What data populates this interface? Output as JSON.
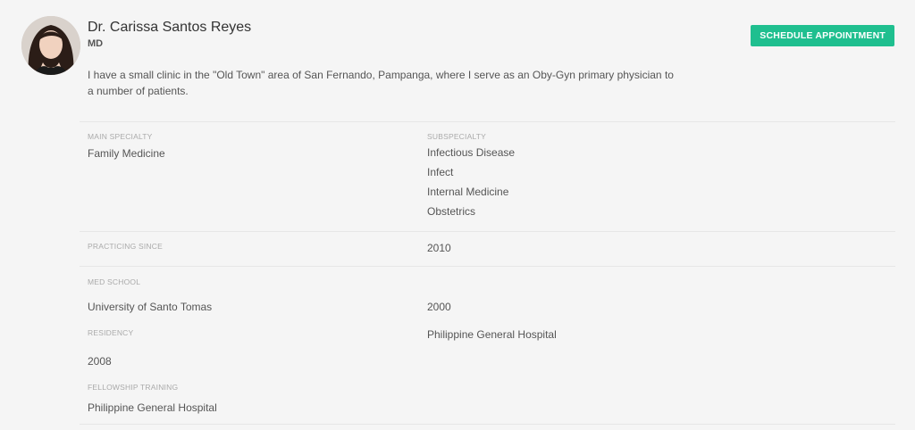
{
  "profile": {
    "name": "Dr. Carissa Santos Reyes",
    "degree": "MD",
    "bio": "I have a small clinic in the \"Old Town\" area of San Fernando, Pampanga, where I serve as an Oby-Gyn primary physician to a number of patients.",
    "cta_label": "SCHEDULE APPOINTMENT",
    "cta_color": "#1fbf8f"
  },
  "specialty": {
    "main_label": "MAIN SPECIALTY",
    "main_value": "Family Medicine",
    "sub_label": "SUBSPECIALTY",
    "sub_values": [
      "Infectious Disease",
      "Infect",
      "Internal Medicine",
      "Obstetrics"
    ]
  },
  "practicing": {
    "label": "PRACTICING SINCE",
    "value": "2010"
  },
  "med_school": {
    "label": "MED SCHOOL",
    "school": "University of Santo Tomas",
    "year": "2000"
  },
  "residency": {
    "label": "RESIDENCY",
    "hospital": "Philippine General Hospital",
    "year": "2008"
  },
  "fellowship": {
    "label": "FELLOWSHIP TRAINING",
    "hospital": "Philippine General Hospital"
  }
}
